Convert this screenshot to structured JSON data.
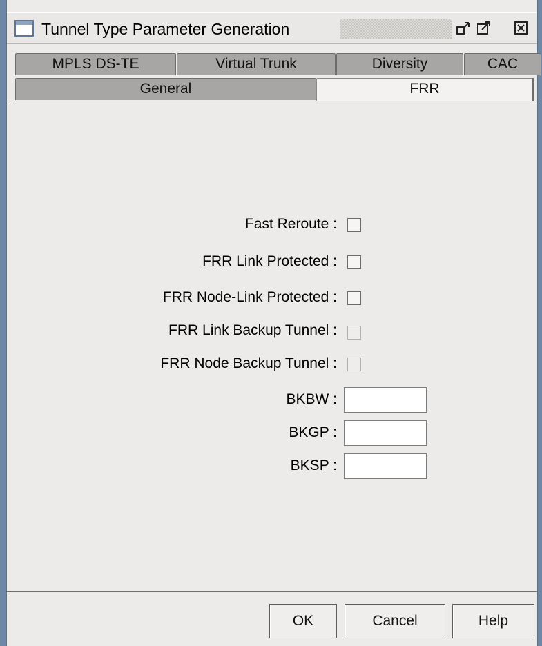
{
  "window": {
    "title": "Tunnel Type Parameter Generation",
    "buttons": [
      "minimize-restore-icon",
      "maximize-icon",
      "close-icon"
    ]
  },
  "tabs": {
    "row1": [
      "MPLS DS-TE",
      "Virtual Trunk",
      "Diversity",
      "CAC"
    ],
    "row2": [
      "General",
      "FRR"
    ],
    "active": "FRR"
  },
  "form": {
    "fast_reroute": {
      "label": "Fast Reroute :",
      "checked": false,
      "enabled": true
    },
    "frr_link_protected": {
      "label": "FRR Link Protected :",
      "checked": false,
      "enabled": true
    },
    "frr_node_link_protected": {
      "label": "FRR Node-Link Protected :",
      "checked": false,
      "enabled": true
    },
    "frr_link_backup_tunnel": {
      "label": "FRR Link Backup Tunnel :",
      "checked": false,
      "enabled": false
    },
    "frr_node_backup_tunnel": {
      "label": "FRR Node Backup Tunnel :",
      "checked": false,
      "enabled": false
    },
    "bkbw": {
      "label": "BKBW :",
      "value": ""
    },
    "bkgp": {
      "label": "BKGP :",
      "value": ""
    },
    "bksp": {
      "label": "BKSP :",
      "value": ""
    }
  },
  "footer": {
    "ok": "OK",
    "cancel": "Cancel",
    "help": "Help"
  },
  "colors": {
    "background": "#6d87a4",
    "panel": "#ecebea",
    "tab_inactive": "#a7a6a4",
    "tab_active": "#f3f2f1"
  }
}
